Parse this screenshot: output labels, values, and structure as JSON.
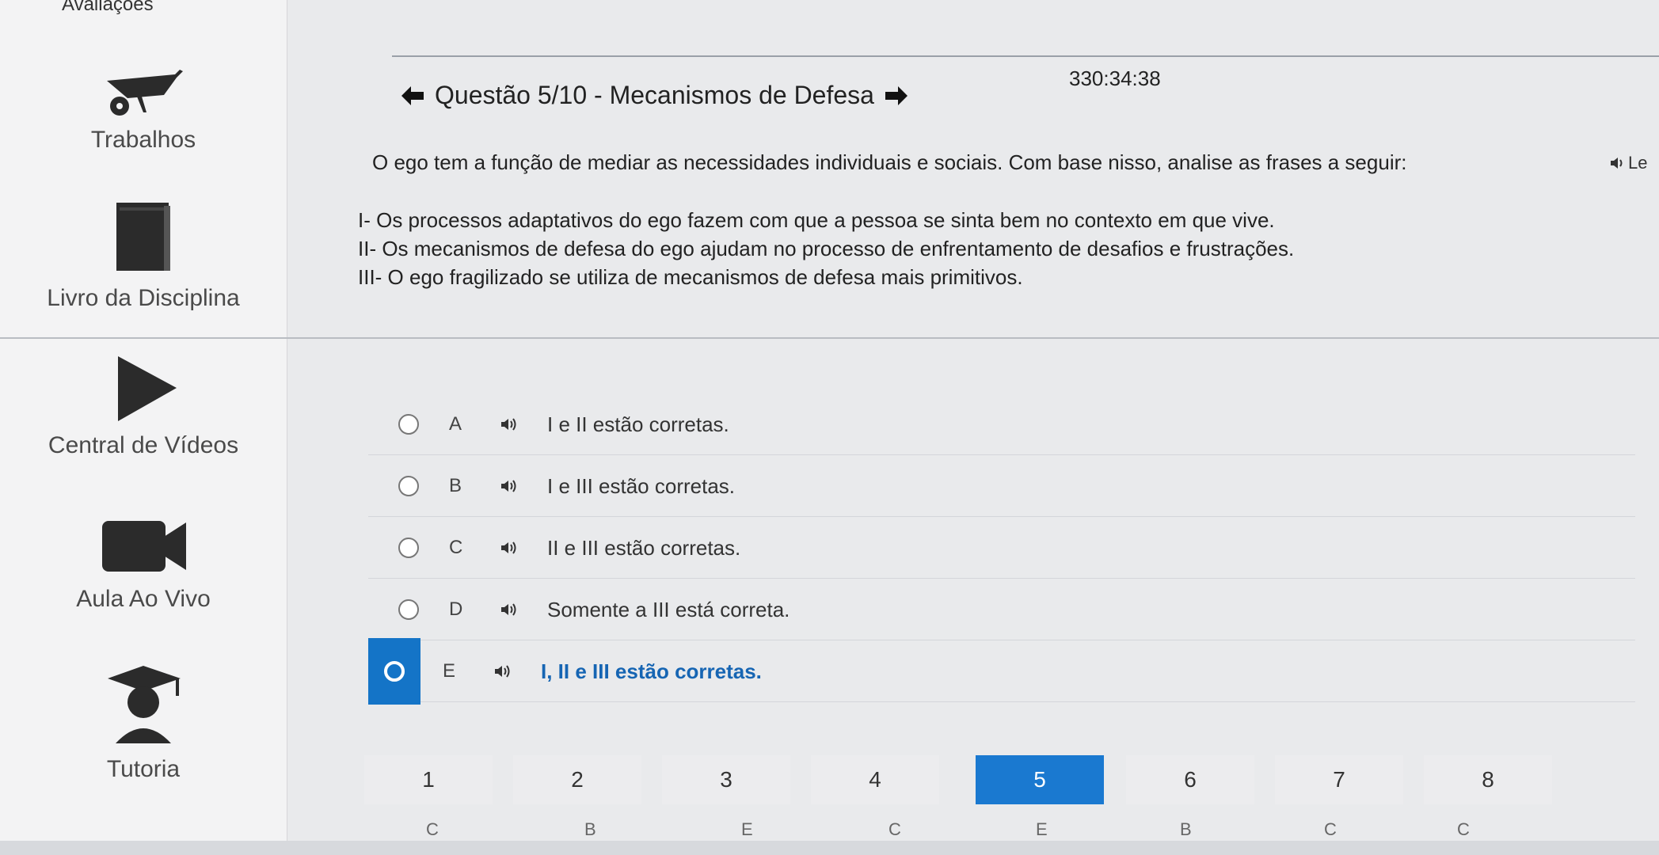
{
  "sidebar": {
    "top_label": "Avaliações",
    "items": [
      {
        "label": "Trabalhos",
        "icon": "wheelbarrow-icon"
      },
      {
        "label": "Livro da Disciplina",
        "icon": "book-icon"
      },
      {
        "label": "Central de Vídeos",
        "icon": "play-icon"
      },
      {
        "label": "Aula Ao Vivo",
        "icon": "video-camera-icon"
      },
      {
        "label": "Tutoria",
        "icon": "graduate-icon"
      }
    ]
  },
  "header": {
    "timer": "330:34:38",
    "question_title": "Questão 5/10 - Mecanismos de Defesa"
  },
  "question": {
    "text": "O ego tem a função de mediar as necessidades individuais e sociais. Com base nisso, analise as frases a seguir:",
    "listen_label": "Le",
    "statements": [
      "I- Os processos adaptativos do ego fazem com que a pessoa se sinta bem no contexto em que vive.",
      "II- Os mecanismos de defesa do ego ajudam no processo de enfrentamento de desafios e frustrações.",
      "III- O ego fragilizado se utiliza de mecanismos de defesa mais primitivos."
    ]
  },
  "options": [
    {
      "letter": "A",
      "text": "I e II estão corretas.",
      "selected": false
    },
    {
      "letter": "B",
      "text": "I e III estão corretas.",
      "selected": false
    },
    {
      "letter": "C",
      "text": "II e III estão corretas.",
      "selected": false
    },
    {
      "letter": "D",
      "text": "Somente a III está correta.",
      "selected": false
    },
    {
      "letter": "E",
      "text": "I, II e III estão corretas.",
      "selected": true
    }
  ],
  "pager": {
    "pages": [
      "1",
      "2",
      "3",
      "4",
      "5",
      "6",
      "7",
      "8"
    ],
    "current": "5",
    "sub_letters": [
      "C",
      "B",
      "E",
      "C",
      "E",
      "B",
      "C",
      "C"
    ]
  },
  "colors": {
    "accent": "#1a79d0",
    "selected_text": "#1665b3"
  }
}
